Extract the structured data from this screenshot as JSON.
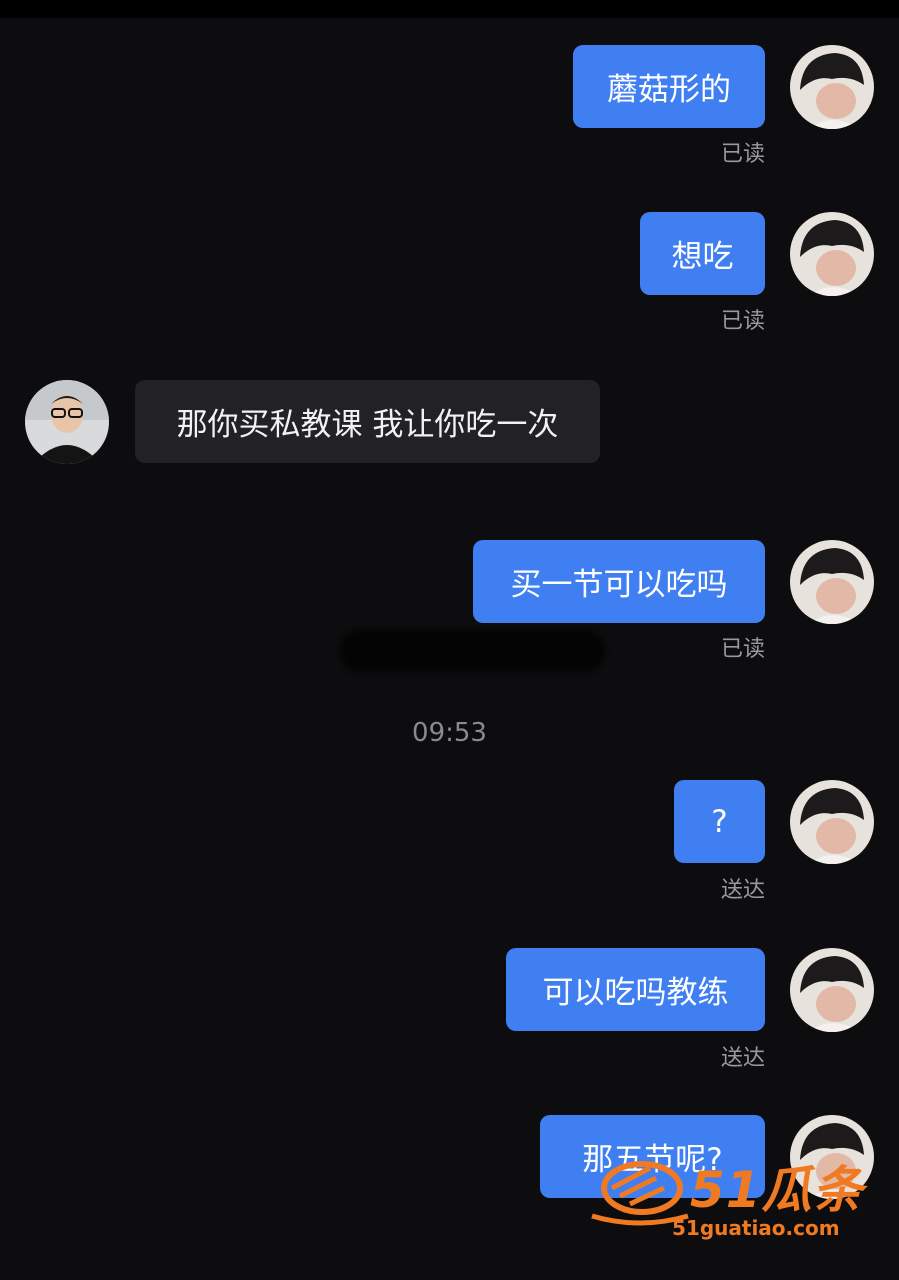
{
  "theme": {
    "bubble_me": "#3f7ff2",
    "bubble_them": "#222226",
    "background": "#0d0d0f"
  },
  "messages": [
    {
      "sender": "me",
      "text": "蘑菇形的",
      "status": "已读"
    },
    {
      "sender": "me",
      "text": "想吃",
      "status": "已读"
    },
    {
      "sender": "them",
      "text": "那你买私教课 我让你吃一次"
    },
    {
      "sender": "me",
      "text": "买一节可以吃吗",
      "status": "已读"
    },
    {
      "sender": "me",
      "text": "?",
      "status": "送达"
    },
    {
      "sender": "me",
      "text": "可以吃吗教练",
      "status": "送达"
    },
    {
      "sender": "me",
      "text": "那五节呢?"
    }
  ],
  "timestamp": "09:53",
  "watermark": {
    "brand": "51瓜条",
    "url": "51guatiao.com"
  }
}
